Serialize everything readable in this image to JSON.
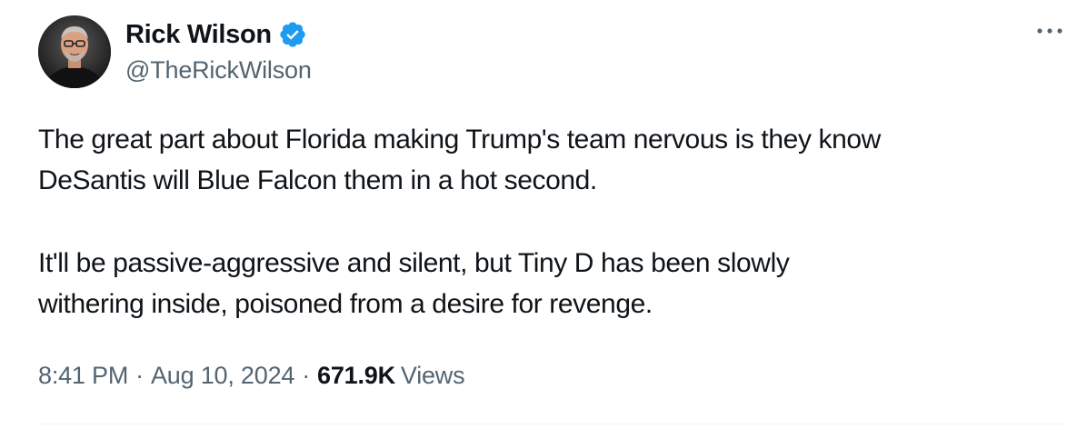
{
  "author": {
    "display_name": "Rick Wilson",
    "handle": "@TheRickWilson",
    "verified": true,
    "avatar_icon": "profile-photo"
  },
  "tweet": {
    "paragraphs": [
      "The great part about Florida making Trump's team nervous is they know\nDeSantis will Blue Falcon them in a hot second.",
      "It'll be passive-aggressive and silent, but Tiny D has been slowly\nwithering inside, poisoned from a desire for revenge."
    ],
    "time": "8:41 PM",
    "date": "Aug 10, 2024",
    "separator": "·",
    "views_count": "671.9K",
    "views_label": "Views"
  },
  "icons": {
    "verified": "verified-badge-icon",
    "more": "more-options-icon"
  },
  "colors": {
    "verified_blue": "#1d9bf0",
    "text_primary": "#0f1419",
    "text_secondary": "#536471"
  }
}
